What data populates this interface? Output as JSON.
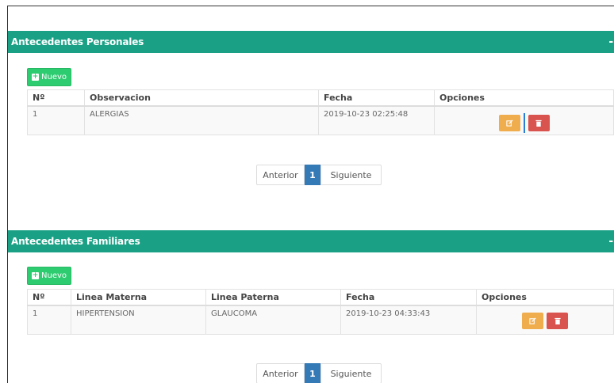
{
  "personales": {
    "title": "Antecedentes Personales",
    "collapse": "-",
    "new_label": "Nuevo",
    "columns": [
      "Nº",
      "Observacion",
      "Fecha",
      "Opciones"
    ],
    "rows": [
      {
        "n": "1",
        "observacion": "ALERGIAS",
        "fecha": "2019-10-23 02:25:48"
      }
    ],
    "pager": {
      "prev": "Anterior",
      "page": "1",
      "next": "Siguiente"
    }
  },
  "familiares": {
    "title": "Antecedentes Familiares",
    "collapse": "-",
    "new_label": "Nuevo",
    "columns": [
      "Nº",
      "Linea Materna",
      "Linea Paterna",
      "Fecha",
      "Opciones"
    ],
    "rows": [
      {
        "n": "1",
        "materna": "HIPERTENSION",
        "paterna": "GLAUCOMA",
        "fecha": "2019-10-23 04:33:43"
      }
    ],
    "pager": {
      "prev": "Anterior",
      "page": "1",
      "next": "Siguiente"
    }
  },
  "colors": {
    "header": "#1aa185",
    "new": "#2ecc71",
    "edit": "#f0ad4e",
    "delete": "#d9534f",
    "page_active": "#337ab7"
  },
  "icons": {
    "edit": "edit-icon",
    "delete": "trash-icon",
    "add": "plus-icon"
  }
}
